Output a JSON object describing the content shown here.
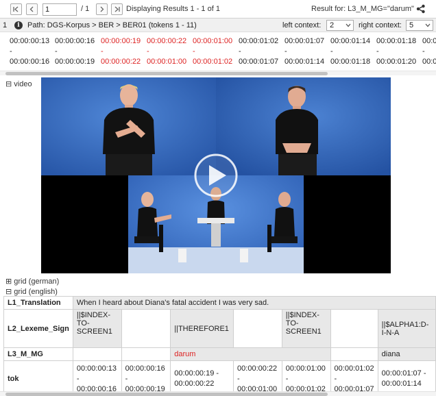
{
  "toolbar": {
    "page_value": "1",
    "page_total": "/ 1",
    "display_text": "Displaying Results 1 - 1 of 1",
    "result_text": "Result for: L3_M_MG=\"darum\""
  },
  "path_bar": {
    "result_num": "1",
    "info_icon_glyph": "i",
    "path_text": "Path: DGS-Korpus > BER > BER01 (tokens 1 - 11)",
    "left_context_label": "left context:",
    "left_context_value": "2",
    "right_context_label": "right context:",
    "right_context_value": "5"
  },
  "timestamps": {
    "start_times": [
      "00:00:00:13",
      "00:00:00:16",
      "00:00:00:19",
      "00:00:00:22",
      "00:00:01:00",
      "00:00:01:02",
      "00:00:01:07",
      "00:00:01:14",
      "00:00:01:18",
      "00:0"
    ],
    "end_times": [
      "00:00:00:16",
      "00:00:00:19",
      "00:00:00:22",
      "00:00:01:00",
      "00:00:01:02",
      "00:00:01:07",
      "00:00:01:14",
      "00:00:01:18",
      "00:00:01:20",
      "00:0"
    ],
    "dash": "-",
    "highlight_color": "#dd2222"
  },
  "video_section": {
    "toggle_glyph": "⊟",
    "label": "video"
  },
  "grid_german": {
    "toggle_glyph": "⊞",
    "label": "grid (german)"
  },
  "grid_english": {
    "toggle_glyph": "⊟",
    "label": "grid (english)"
  },
  "grid": {
    "rows": {
      "translation": {
        "label": "L1_Translation",
        "text": "When I heard about Diana's fatal accident I was very sad."
      },
      "lexeme": {
        "label": "L2_Lexeme_Sign",
        "cells": [
          "||$INDEX-TO-SCREEN1",
          "||THEREFORE1",
          "||$INDEX-TO-SCREEN1",
          "||$ALPHA1:D-I-N-A"
        ]
      },
      "mouth": {
        "label": "L3_M_MG",
        "cells": [
          "darum",
          "diana"
        ]
      },
      "tok": {
        "label": "tok",
        "cells": [
          [
            "00:00:00:13",
            "-",
            "00:00:00:16"
          ],
          [
            "00:00:00:16",
            "-",
            "00:00:00:19"
          ],
          [
            "00:00:00:19 -",
            "00:00:00:22"
          ],
          [
            "00:00:00:22",
            "-",
            "00:00:01:00"
          ],
          [
            "00:00:01:00",
            "-",
            "00:00:01:02"
          ],
          [
            "00:00:01:02",
            "-",
            "00:00:01:07"
          ],
          [
            "00:00:01:07 -",
            "00:00:01:14"
          ]
        ]
      }
    }
  },
  "colors": {
    "accent_red": "#dd2222",
    "video_background": "#000000",
    "studio_blue": "#3a6fc4"
  }
}
